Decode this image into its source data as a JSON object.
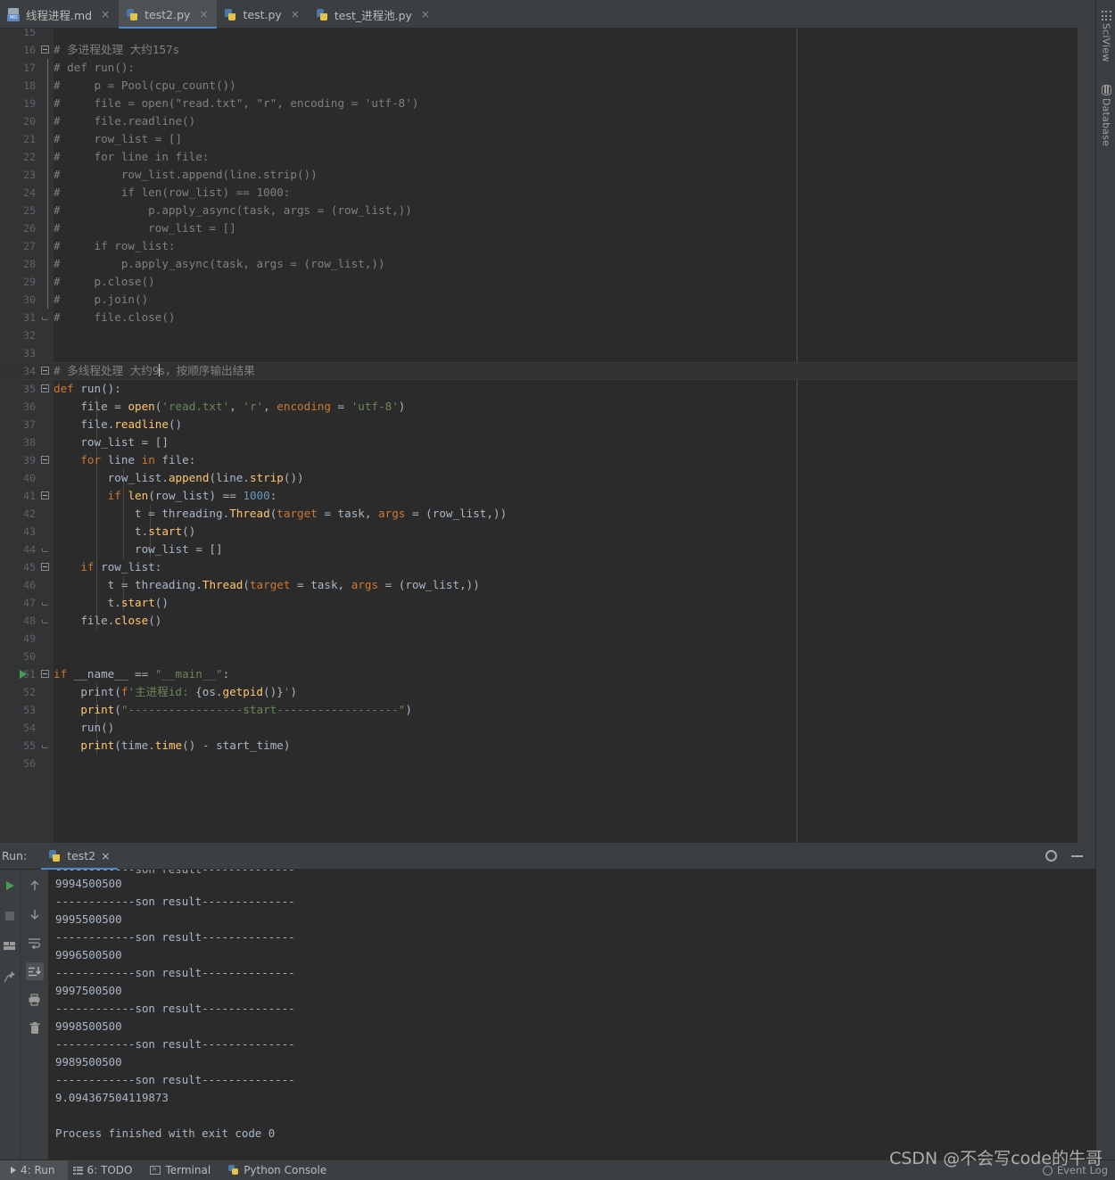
{
  "window": {
    "theme_bg": "#2b2b2b",
    "chrome_bg": "#3c3f41",
    "accent": "#4a88c7"
  },
  "tabs": [
    {
      "label": "线程进程.md",
      "icon": "markdown-file-icon",
      "active": false,
      "close": "×"
    },
    {
      "label": "test2.py",
      "icon": "python-file-icon",
      "active": true,
      "close": "×"
    },
    {
      "label": "test.py",
      "icon": "python-file-icon",
      "active": false,
      "close": "×"
    },
    {
      "label": "test_进程池.py",
      "icon": "python-file-icon",
      "active": false,
      "close": "×"
    }
  ],
  "editor": {
    "first_visible_line": 15,
    "current_line": 34,
    "caret_line": 34,
    "margin_guide_column_x": 893,
    "lines": [
      {
        "n": 15,
        "text": ""
      },
      {
        "n": 16,
        "text": "# 多进程处理 大约157s",
        "cls": "c-com",
        "fold": "start"
      },
      {
        "n": 17,
        "text": "# def run():",
        "cls": "c-com",
        "fold": "bar"
      },
      {
        "n": 18,
        "text": "#     p = Pool(cpu_count())",
        "cls": "c-com",
        "fold": "bar"
      },
      {
        "n": 19,
        "text": "#     file = open(\"read.txt\", \"r\", encoding = 'utf-8')",
        "cls": "c-com",
        "fold": "bar"
      },
      {
        "n": 20,
        "text": "#     file.readline()",
        "cls": "c-com",
        "fold": "bar"
      },
      {
        "n": 21,
        "text": "#     row_list = []",
        "cls": "c-com",
        "fold": "bar"
      },
      {
        "n": 22,
        "text": "#     for line in file:",
        "cls": "c-com",
        "fold": "bar"
      },
      {
        "n": 23,
        "text": "#         row_list.append(line.strip())",
        "cls": "c-com",
        "fold": "bar"
      },
      {
        "n": 24,
        "text": "#         if len(row_list) == 1000:",
        "cls": "c-com",
        "fold": "bar"
      },
      {
        "n": 25,
        "text": "#             p.apply_async(task, args = (row_list,))",
        "cls": "c-com",
        "fold": "bar"
      },
      {
        "n": 26,
        "text": "#             row_list = []",
        "cls": "c-com",
        "fold": "bar"
      },
      {
        "n": 27,
        "text": "#     if row_list:",
        "cls": "c-com",
        "fold": "bar"
      },
      {
        "n": 28,
        "text": "#         p.apply_async(task, args = (row_list,))",
        "cls": "c-com",
        "fold": "bar"
      },
      {
        "n": 29,
        "text": "#     p.close()",
        "cls": "c-com",
        "fold": "bar"
      },
      {
        "n": 30,
        "text": "#     p.join()",
        "cls": "c-com",
        "fold": "bar"
      },
      {
        "n": 31,
        "text": "#     file.close()",
        "cls": "c-com",
        "fold": "end"
      },
      {
        "n": 32,
        "text": ""
      },
      {
        "n": 33,
        "text": ""
      },
      {
        "n": 34,
        "text": "# 多线程处理 大约9s，按顺序输出结果",
        "cls": "c-com",
        "fold": "start",
        "caret_after": "# 多线程处理 大约9"
      },
      {
        "n": 35,
        "text": "def run():",
        "fold": "start"
      },
      {
        "n": 36,
        "text": "    file = open('read.txt', 'r', encoding = 'utf-8')"
      },
      {
        "n": 37,
        "text": "    file.readline()"
      },
      {
        "n": 38,
        "text": "    row_list = []"
      },
      {
        "n": 39,
        "text": "    for line in file:",
        "fold": "start2"
      },
      {
        "n": 40,
        "text": "        row_list.append(line.strip())"
      },
      {
        "n": 41,
        "text": "        if len(row_list) == 1000:",
        "fold": "start3"
      },
      {
        "n": 42,
        "text": "            t = threading.Thread(target = task, args = (row_list,))"
      },
      {
        "n": 43,
        "text": "            t.start()"
      },
      {
        "n": 44,
        "text": "            row_list = []",
        "fold": "end3"
      },
      {
        "n": 45,
        "text": "    if row_list:",
        "fold": "start2b"
      },
      {
        "n": 46,
        "text": "        t = threading.Thread(target = task, args = (row_list,))"
      },
      {
        "n": 47,
        "text": "        t.start()",
        "fold": "end2"
      },
      {
        "n": 48,
        "text": "    file.close()",
        "fold": "end"
      },
      {
        "n": 49,
        "text": ""
      },
      {
        "n": 50,
        "text": ""
      },
      {
        "n": 51,
        "text": "if __name__ == \"__main__\":",
        "fold": "start",
        "gutter_run": true
      },
      {
        "n": 52,
        "text": "    print(f'主进程id: {os.getpid()}')"
      },
      {
        "n": 53,
        "text": "    print(\"-----------------start------------------\")"
      },
      {
        "n": 54,
        "text": "    run()"
      },
      {
        "n": 55,
        "text": "    print(time.time() - start_time)",
        "fold": "end"
      },
      {
        "n": 56,
        "text": ""
      }
    ]
  },
  "right_strip": {
    "items": [
      {
        "label": "SciView",
        "icon": "grid-icon"
      },
      {
        "label": "Database",
        "icon": "database-icon"
      }
    ]
  },
  "run_panel": {
    "title": "Run:",
    "tab_label": "test2",
    "tab_icon": "python-icon",
    "tab_close": "×",
    "gear_icon": "gear-icon",
    "minimize_icon": "minimize-icon",
    "toolbar_left": [
      {
        "icon": "rerun-icon"
      },
      {
        "icon": "stop-icon"
      },
      {
        "icon": "layout-icon"
      },
      {
        "icon": "pin-icon"
      }
    ],
    "toolbar_right": [
      {
        "icon": "arrow-up-icon"
      },
      {
        "icon": "arrow-down-icon"
      },
      {
        "icon": "soft-wrap-icon"
      },
      {
        "icon": "scroll-to-end-icon",
        "selected": true
      },
      {
        "icon": "print-icon"
      },
      {
        "icon": "trash-icon"
      }
    ],
    "console_lines": [
      "9994500500",
      "------------son result--------------",
      "9995500500",
      "------------son result--------------",
      "9996500500",
      "------------son result--------------",
      "9997500500",
      "------------son result--------------",
      "9998500500",
      "------------son result--------------",
      "9989500500",
      "------------son result--------------",
      "9.094367504119873",
      "",
      "Process finished with exit code 0"
    ]
  },
  "status_bar": {
    "items": [
      {
        "label": "4: Run",
        "num": "4",
        "rest": ": Run",
        "icon": "run-arrow-icon",
        "active": true
      },
      {
        "label": "6: TODO",
        "num": "6",
        "rest": ": TODO",
        "icon": "todo-icon",
        "active": false
      },
      {
        "label": "Terminal",
        "icon": "terminal-icon",
        "active": false
      },
      {
        "label": "Python Console",
        "icon": "python-console-icon",
        "active": false
      }
    ],
    "event_log": "Event Log",
    "watermark": "CSDN @不会写code的牛哥"
  }
}
